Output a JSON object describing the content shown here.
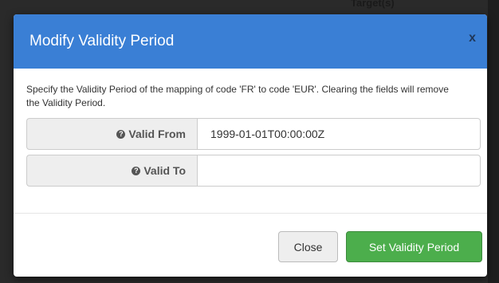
{
  "backdrop": {
    "partial_text": "Target(s)"
  },
  "modal": {
    "title": "Modify Validity Period",
    "close_x": "x",
    "description": "Specify the Validity Period of the mapping of code 'FR' to code 'EUR'. Clearing the fields will remove the Validity Period.",
    "fields": [
      {
        "label": "Valid From",
        "value": "1999-01-01T00:00:00Z",
        "placeholder": ""
      },
      {
        "label": "Valid To",
        "value": "",
        "placeholder": ""
      }
    ],
    "buttons": {
      "close_label": "Close",
      "submit_label": "Set Validity Period"
    }
  },
  "colors": {
    "header": "#3a7fd5",
    "submit": "#4cae4c"
  },
  "icons": {
    "help": "question-circle-icon"
  }
}
